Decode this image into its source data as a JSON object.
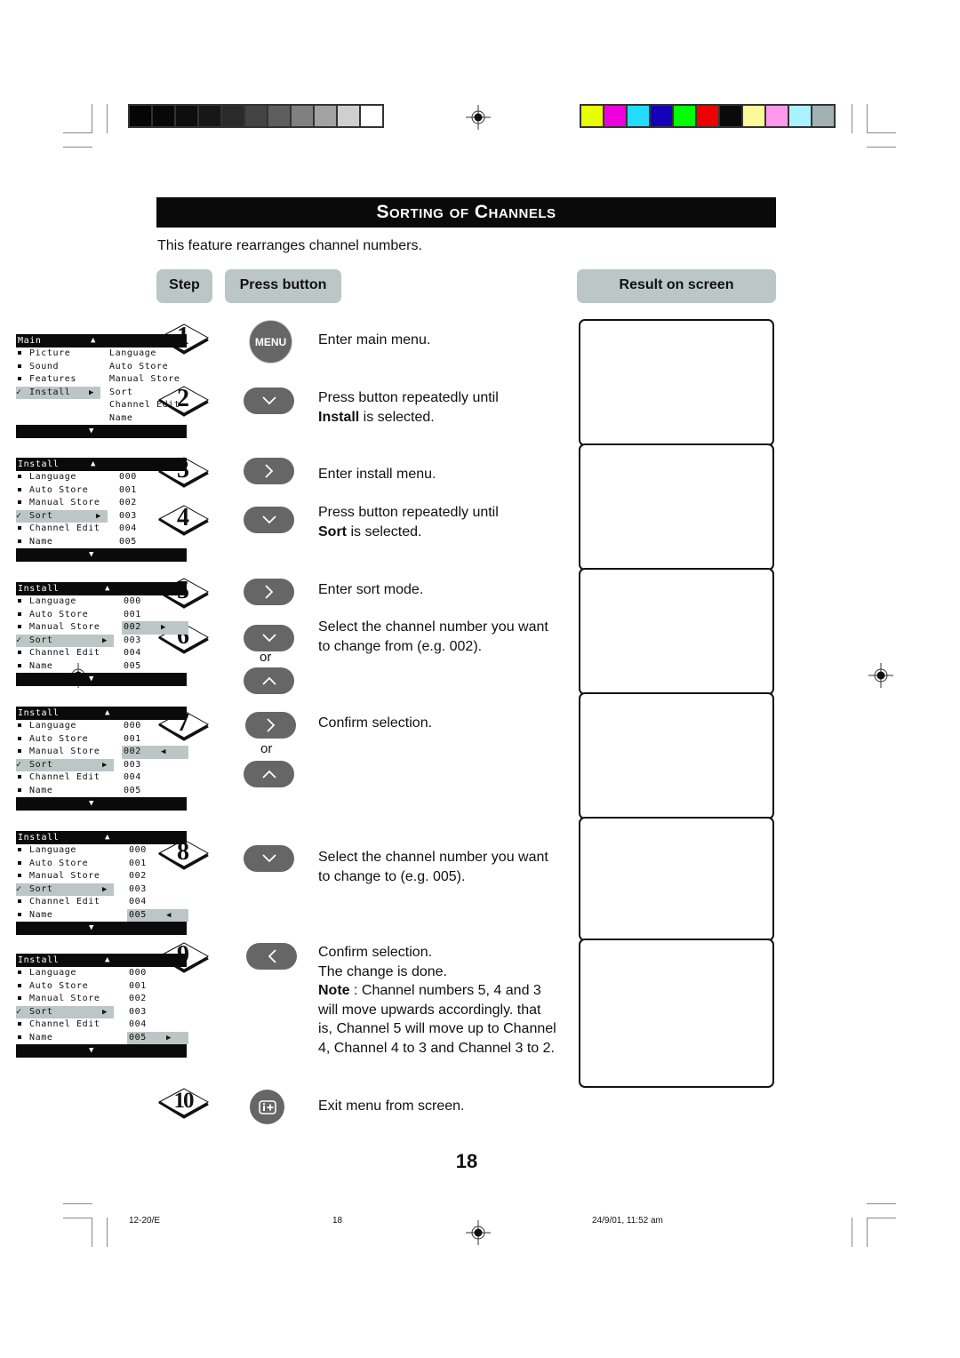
{
  "print_marks": {
    "gray_scale": [
      "#050505",
      "#080808",
      "#0e0e0e",
      "#171717",
      "#2a2a2a",
      "#444444",
      "#5e5e5e",
      "#808080",
      "#a2a2a2",
      "#cfcfcf",
      "#ffffff"
    ],
    "color_scale": [
      "#e8ff00",
      "#ee00dd",
      "#22ddff",
      "#1400bb",
      "#00ff00",
      "#ee0000",
      "#0a0a0a",
      "#fafa99",
      "#ff99ee",
      "#aaf2ff",
      "#a2b2b2"
    ]
  },
  "title": "Sorting of Channels",
  "intro": "This feature rearranges channel numbers.",
  "headers": {
    "step": "Step",
    "press_button": "Press button",
    "result": "Result on screen"
  },
  "steps": [
    {
      "num": "1",
      "button": "MENU",
      "button_icon": "menu-button",
      "desc": "Enter main menu."
    },
    {
      "num": "2",
      "button_icon": "down-arrow-button",
      "desc_pre": "Press button repeatedly until",
      "desc_bold": "Install",
      "desc_post": " is selected."
    },
    {
      "num": "3",
      "button_icon": "right-arrow-button",
      "desc": "Enter install menu."
    },
    {
      "num": "4",
      "button_icon": "down-arrow-button",
      "desc_pre": "Press button repeatedly until",
      "desc_bold": "Sort",
      "desc_post": " is selected."
    },
    {
      "num": "5",
      "button_icon": "right-arrow-button",
      "desc": "Enter sort mode."
    },
    {
      "num": "6",
      "button_icon": "down-arrow-button",
      "alt_button_icon": "up-arrow-button",
      "or": "or",
      "desc_l1": "Select the channel number you want",
      "desc_l2": "to change from (e.g. 002)."
    },
    {
      "num": "7",
      "button_icon": "right-arrow-button",
      "alt_button_icon": "up-arrow-button",
      "or": "or",
      "desc": "Confirm selection."
    },
    {
      "num": "8",
      "button_icon": "down-arrow-button",
      "desc_l1": "Select the channel number you want",
      "desc_l2": "to change to (e.g. 005)."
    },
    {
      "num": "9",
      "button_icon": "left-arrow-button",
      "desc_l1": "Confirm selection.",
      "desc_l2": "The change is done.",
      "note_label": "Note",
      "note_l1": " : Channel numbers 5, 4 and 3",
      "note_l2": "will move upwards accordingly. that",
      "note_l3": "is, Channel 5 will move up to Channel",
      "note_l4": "4, Channel 4 to 3 and Channel 3 to 2."
    },
    {
      "num": "10",
      "button_icon": "info-plus-button",
      "desc": "Exit menu from screen."
    }
  ],
  "screens": [
    {
      "title": "Main",
      "items": [
        "Picture",
        "Sound",
        "Features",
        "Install"
      ],
      "selected": "Install",
      "submenu": [
        "Language",
        "Auto Store",
        "Manual Store",
        "Sort",
        "Channel Edit",
        "Name"
      ]
    },
    {
      "title": "Install",
      "items": [
        "Language",
        "Auto Store",
        "Manual Store",
        "Sort",
        "Channel Edit",
        "Name"
      ],
      "selected": "Sort",
      "values": [
        "000",
        "001",
        "002",
        "003",
        "004",
        "005"
      ]
    },
    {
      "title": "Install",
      "items": [
        "Language",
        "Auto Store",
        "Manual Store",
        "Sort",
        "Channel Edit",
        "Name"
      ],
      "selected": "Sort",
      "values": [
        "000",
        "001",
        "002",
        "003",
        "004",
        "005"
      ],
      "value_highlight": "002",
      "value_arrow": "right"
    },
    {
      "title": "Install",
      "items": [
        "Language",
        "Auto Store",
        "Manual Store",
        "Sort",
        "Channel Edit",
        "Name"
      ],
      "selected": "Sort",
      "values": [
        "000",
        "001",
        "002",
        "003",
        "004",
        "005"
      ],
      "value_highlight": "002",
      "value_arrow": "left"
    },
    {
      "title": "Install",
      "items": [
        "Language",
        "Auto Store",
        "Manual Store",
        "Sort",
        "Channel Edit",
        "Name"
      ],
      "selected": "Sort",
      "values": [
        "000",
        "001",
        "002",
        "003",
        "004",
        "005"
      ],
      "value_highlight": "005",
      "value_arrow": "left"
    },
    {
      "title": "Install",
      "items": [
        "Language",
        "Auto Store",
        "Manual Store",
        "Sort",
        "Channel Edit",
        "Name"
      ],
      "selected": "Sort",
      "values": [
        "000",
        "001",
        "002",
        "003",
        "004",
        "005"
      ],
      "value_highlight": "005",
      "value_arrow": "right"
    }
  ],
  "page_number": "18",
  "footer": {
    "code": "12-20/E",
    "page": "18",
    "timestamp": "24/9/01, 11:52 am"
  }
}
